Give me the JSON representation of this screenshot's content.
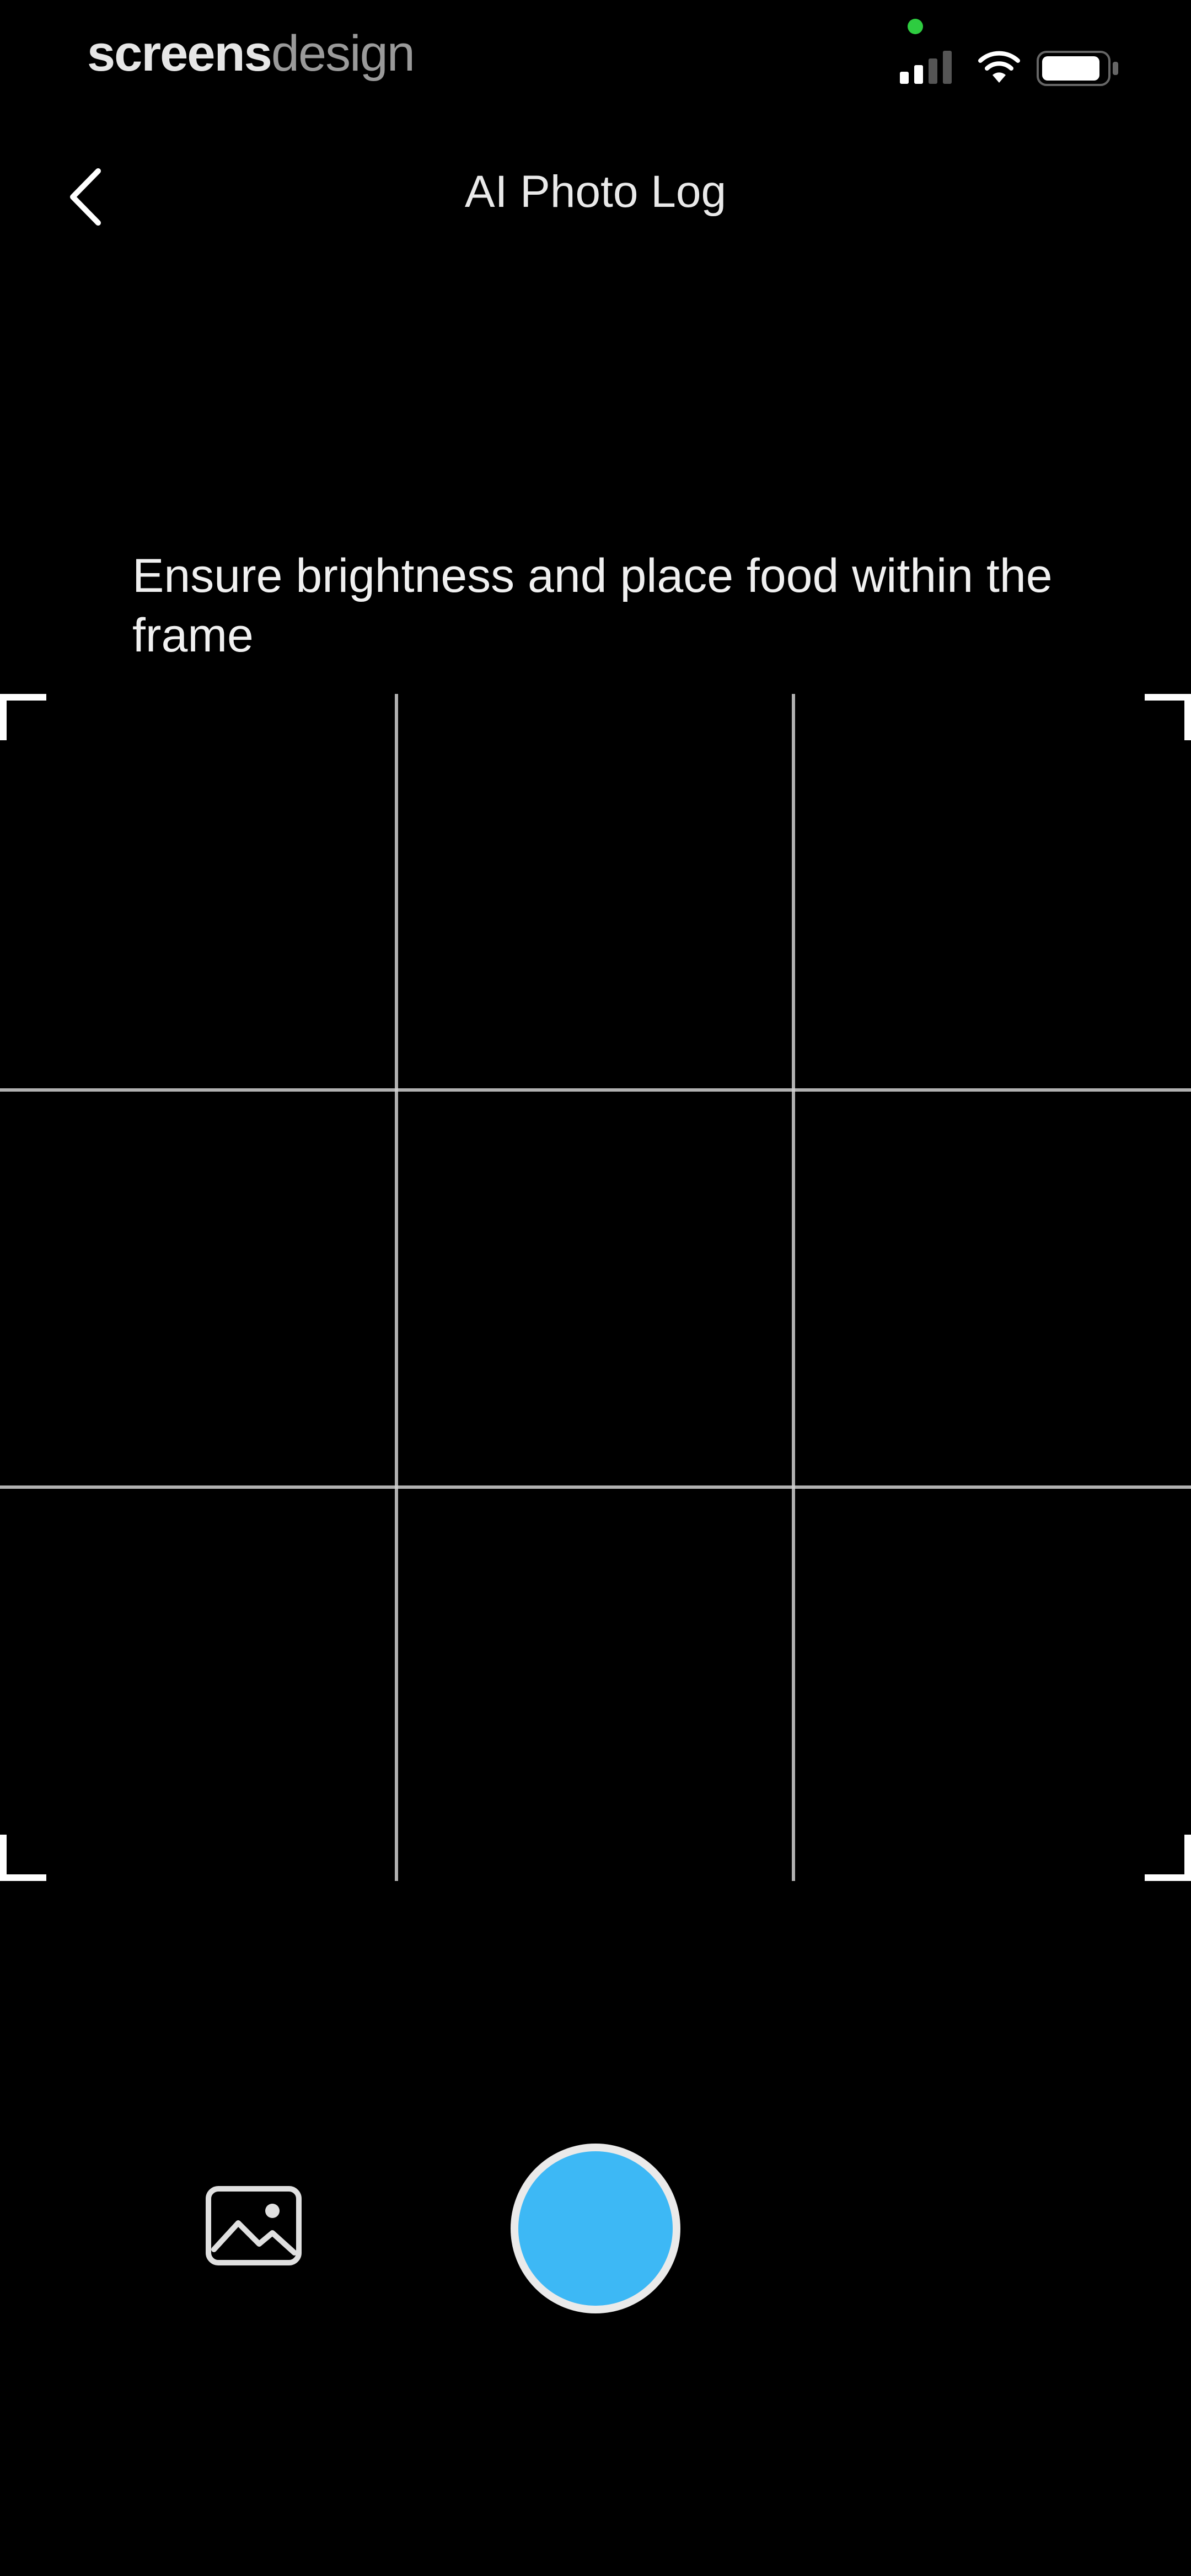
{
  "status_bar": {
    "brand_part_1": "screens",
    "brand_part_2": "design",
    "privacy_dot_color": "#2ecc40",
    "icons": [
      "signal-icon",
      "wifi-icon",
      "battery-icon"
    ]
  },
  "nav": {
    "back_icon": "chevron-left-icon",
    "title": "AI Photo Log"
  },
  "camera": {
    "instruction": "Ensure brightness and place food within the frame",
    "grid": "3x3",
    "frame_corners": [
      "top-left",
      "top-right",
      "bottom-left",
      "bottom-right"
    ]
  },
  "controls": {
    "gallery_icon": "gallery-icon",
    "shutter_color": "#3db8f5"
  }
}
